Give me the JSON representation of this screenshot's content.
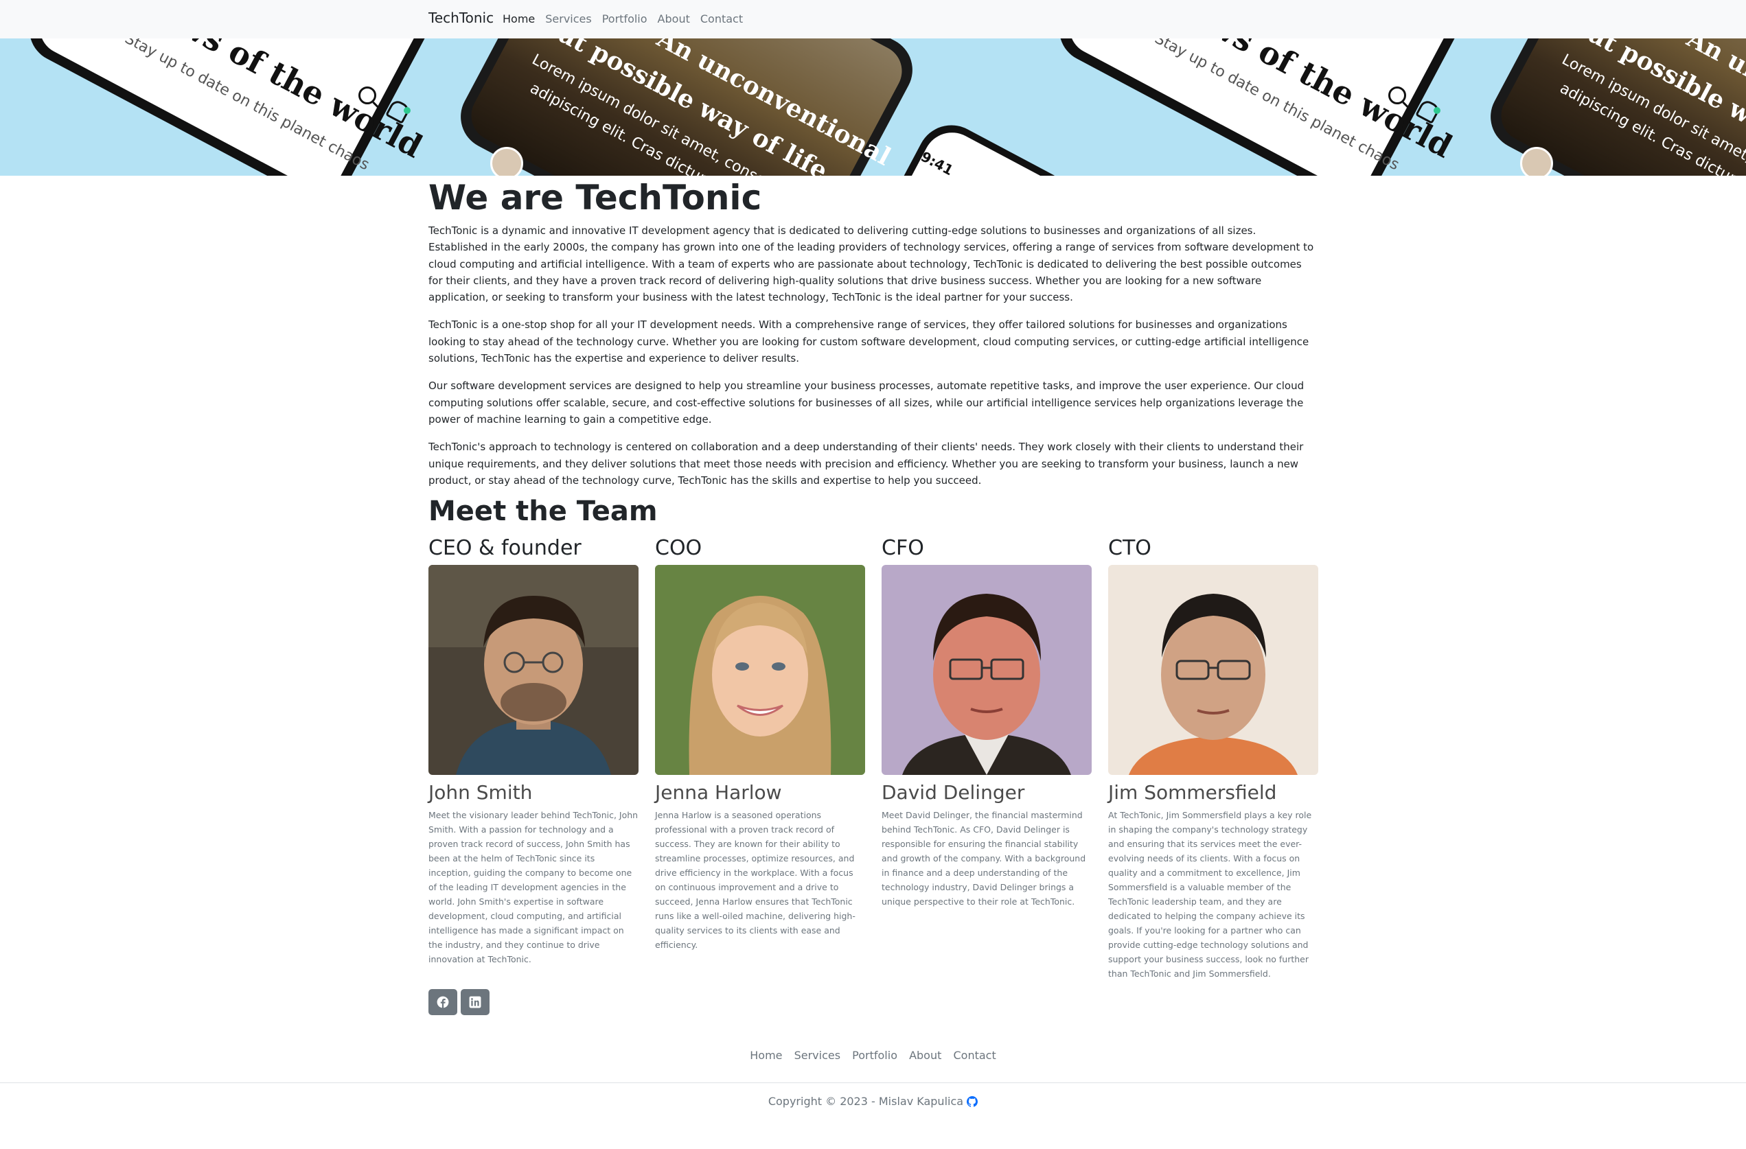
{
  "navbar": {
    "brand": "TechTonic",
    "links": [
      "Home",
      "Services",
      "Portfolio",
      "About",
      "Contact"
    ],
    "active": "Home"
  },
  "banner": {
    "news_title": "News of the world",
    "news_subtitle": "Stay up to date on this planet chaos",
    "nomad_title_line1": "Nomads. An unconventional",
    "nomad_title_line2": "but possible way of life.",
    "nomad_body_line1": "Lorem ipsum dolor sit amet, consectetur",
    "nomad_body_line2": "adipiscing elit. Cras dictum tristique",
    "clock": "9:41"
  },
  "about": {
    "title": "We are TechTonic",
    "paragraphs": [
      "TechTonic is a dynamic and innovative IT development agency that is dedicated to delivering cutting-edge solutions to businesses and organizations of all sizes. Established in the early 2000s, the company has grown into one of the leading providers of technology services, offering a range of services from software development to cloud computing and artificial intelligence. With a team of experts who are passionate about technology, TechTonic is dedicated to delivering the best possible outcomes for their clients, and they have a proven track record of delivering high-quality solutions that drive business success. Whether you are looking for a new software application, or seeking to transform your business with the latest technology, TechTonic is the ideal partner for your success.",
      "TechTonic is a one-stop shop for all your IT development needs. With a comprehensive range of services, they offer tailored solutions for businesses and organizations looking to stay ahead of the technology curve. Whether you are looking for custom software development, cloud computing services, or cutting-edge artificial intelligence solutions, TechTonic has the expertise and experience to deliver results.",
      "Our software development services are designed to help you streamline your business processes, automate repetitive tasks, and improve the user experience. Our cloud computing solutions offer scalable, secure, and cost-effective solutions for businesses of all sizes, while our artificial intelligence services help organizations leverage the power of machine learning to gain a competitive edge.",
      "TechTonic's approach to technology is centered on collaboration and a deep understanding of their clients' needs. They work closely with their clients to understand their unique requirements, and they deliver solutions that meet those needs with precision and efficiency. Whether you are seeking to transform your business, launch a new product, or stay ahead of the technology curve, TechTonic has the skills and expertise to help you succeed."
    ]
  },
  "team": {
    "title": "Meet the Team",
    "members": [
      {
        "role": "CEO & founder",
        "name": "John Smith",
        "bio": "Meet the visionary leader behind TechTonic, John Smith. With a passion for technology and a proven track record of success, John Smith has been at the helm of TechTonic since its inception, guiding the company to become one of the leading IT development agencies in the world. John Smith's expertise in software development, cloud computing, and artificial intelligence has made a significant impact on the industry, and they continue to drive innovation at TechTonic."
      },
      {
        "role": "COO",
        "name": "Jenna Harlow",
        "bio": "Jenna Harlow is a seasoned operations professional with a proven track record of success. They are known for their ability to streamline processes, optimize resources, and drive efficiency in the workplace. With a focus on continuous improvement and a drive to succeed, Jenna Harlow ensures that TechTonic runs like a well-oiled machine, delivering high-quality services to its clients with ease and efficiency."
      },
      {
        "role": "CFO",
        "name": "David Delinger",
        "bio": "Meet David Delinger, the financial mastermind behind TechTonic. As CFO, David Delinger is responsible for ensuring the financial stability and growth of the company. With a background in finance and a deep understanding of the technology industry, David Delinger brings a unique perspective to their role at TechTonic."
      },
      {
        "role": "CTO",
        "name": "Jim Sommersfield",
        "bio": "At TechTonic, Jim Sommersfield plays a key role in shaping the company's technology strategy and ensuring that its services meet the ever-evolving needs of its clients. With a focus on quality and a commitment to excellence, Jim Sommersfield is a valuable member of the TechTonic leadership team, and they are dedicated to helping the company achieve its goals. If you're looking for a partner who can provide cutting-edge technology solutions and support your business success, look no further than TechTonic and Jim Sommersfield."
      }
    ]
  },
  "socials": [
    "facebook-icon",
    "linkedin-icon"
  ],
  "footer": {
    "links": [
      "Home",
      "Services",
      "Portfolio",
      "About",
      "Contact"
    ],
    "copyright": "Copyright © 2023 - Mislav Kapulica"
  },
  "colors": {
    "navbar_bg": "#f8f9fa",
    "banner_bg": "#b4e2f4",
    "button_bg": "#6c757d",
    "github_icon": "#0d6efd"
  }
}
